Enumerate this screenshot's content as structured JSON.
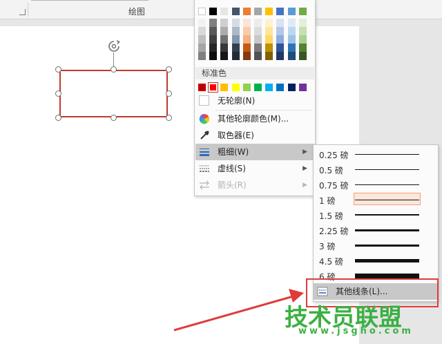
{
  "ribbon": {
    "group_label": "绘图"
  },
  "outline_menu": {
    "standard_colors_label": "标准色",
    "theme_colors": [
      [
        "#ffffff",
        "#f2f2f2",
        "#d9d9d9",
        "#bfbfbf",
        "#a6a6a6",
        "#808080"
      ],
      [
        "#000000",
        "#808080",
        "#595959",
        "#404040",
        "#262626",
        "#0d0d0d"
      ],
      [
        "#e7e6e6",
        "#d0cece",
        "#aeabab",
        "#757171",
        "#3a3838",
        "#171616"
      ],
      [
        "#44546a",
        "#d6dce4",
        "#adb9ca",
        "#8497b0",
        "#333f50",
        "#222a35"
      ],
      [
        "#ed7d31",
        "#fbe5d6",
        "#f8cbad",
        "#f4b183",
        "#c55a11",
        "#843c0c"
      ],
      [
        "#a5a5a5",
        "#ededed",
        "#dbdbdb",
        "#c9c9c9",
        "#7b7b7b",
        "#525252"
      ],
      [
        "#ffc000",
        "#fff2cc",
        "#ffe699",
        "#ffd966",
        "#bf9000",
        "#7f6000"
      ],
      [
        "#4472c4",
        "#dae3f3",
        "#b4c7e7",
        "#8faadc",
        "#2f5597",
        "#203864"
      ],
      [
        "#5b9bd5",
        "#deebf7",
        "#bdd7ee",
        "#9dc3e6",
        "#2e75b6",
        "#1f4e79"
      ],
      [
        "#70ad47",
        "#e2f0d9",
        "#c5e0b4",
        "#a9d18e",
        "#548235",
        "#385723"
      ]
    ],
    "standard_colors": [
      "#c00000",
      "#ff0000",
      "#ffc000",
      "#ffff00",
      "#92d050",
      "#00b050",
      "#00b0f0",
      "#0070c0",
      "#002060",
      "#7030a0"
    ],
    "selected_standard_color": "#ff0000",
    "items": {
      "no_outline": "无轮廓(N)",
      "more_colors": "其他轮廓颜色(M)...",
      "eyedropper": "取色器(E)",
      "weight": "粗细(W)",
      "dashes": "虚线(S)",
      "arrows": "箭头(R)"
    }
  },
  "weight_menu": {
    "options": [
      {
        "label": "0.25 磅",
        "pt": 0.25
      },
      {
        "label": "0.5 磅",
        "pt": 0.5
      },
      {
        "label": "0.75 磅",
        "pt": 0.75
      },
      {
        "label": "1 磅",
        "pt": 1,
        "selected": true
      },
      {
        "label": "1.5 磅",
        "pt": 1.5
      },
      {
        "label": "2.25 磅",
        "pt": 2.25
      },
      {
        "label": "3 磅",
        "pt": 3
      },
      {
        "label": "4.5 磅",
        "pt": 4.5
      },
      {
        "label": "6 磅",
        "pt": 6
      }
    ],
    "more_lines": "其他线条(L)..."
  },
  "watermark": {
    "title": "技术员联盟",
    "url": "www.jsgho.com"
  },
  "colors": {
    "shape_outline": "#c0392b",
    "highlight": "#c8c8c8",
    "annotation": "#e03a3a",
    "watermark": "#3cb043"
  }
}
